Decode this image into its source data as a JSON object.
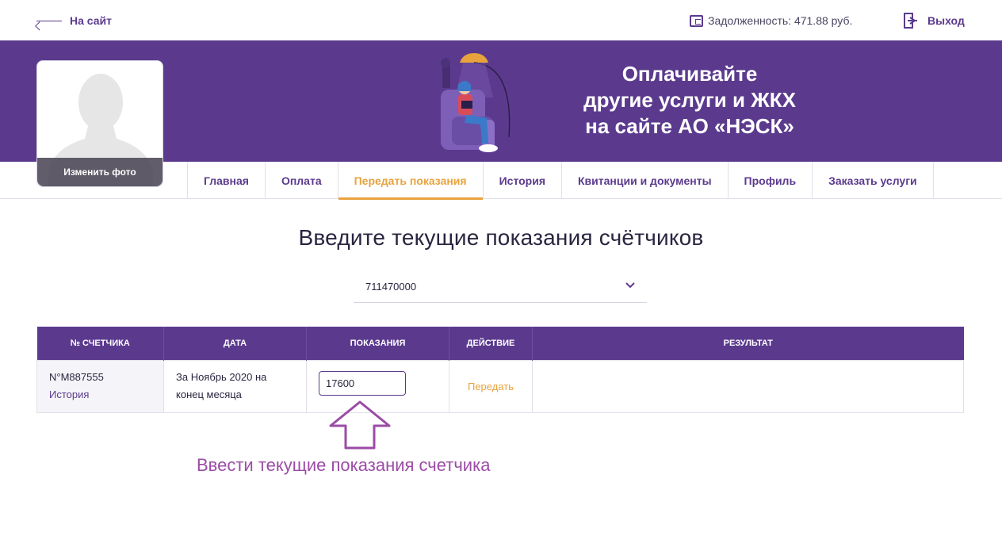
{
  "topbar": {
    "back_label": "На сайт",
    "debt_label": "Задолженность: 471.88 руб.",
    "logout_label": "Выход"
  },
  "banner": {
    "line1": "Оплачивайте",
    "line2": "другие услуги и ЖКХ",
    "line3": "на сайте АО «НЭСК»"
  },
  "avatar": {
    "change_photo_label": "Изменить фото"
  },
  "nav": {
    "tabs": [
      {
        "label": "Главная",
        "active": false
      },
      {
        "label": "Оплата",
        "active": false
      },
      {
        "label": "Передать показания",
        "active": true
      },
      {
        "label": "История",
        "active": false
      },
      {
        "label": "Квитанции и документы",
        "active": false
      },
      {
        "label": "Профиль",
        "active": false
      },
      {
        "label": "Заказать услуги",
        "active": false
      }
    ]
  },
  "main": {
    "title": "Введите текущие показания счётчиков",
    "account_selected": "711470000"
  },
  "table": {
    "headers": [
      "№ счетчика",
      "Дата",
      "Показания",
      "Действие",
      "Результат"
    ],
    "rows": [
      {
        "meter_number": "N°M887555",
        "history_label": "История",
        "date_line1": "За Ноябрь 2020 на",
        "date_line2": "конец месяца",
        "reading_value": "17600",
        "action_label": "Передать",
        "result": ""
      }
    ]
  },
  "annotation": {
    "text": "Ввести текущие показания счетчика"
  },
  "colors": {
    "brand_purple": "#5b3a8e",
    "accent_orange": "#e8a33d",
    "annotation_purple": "#9b4ca6"
  }
}
